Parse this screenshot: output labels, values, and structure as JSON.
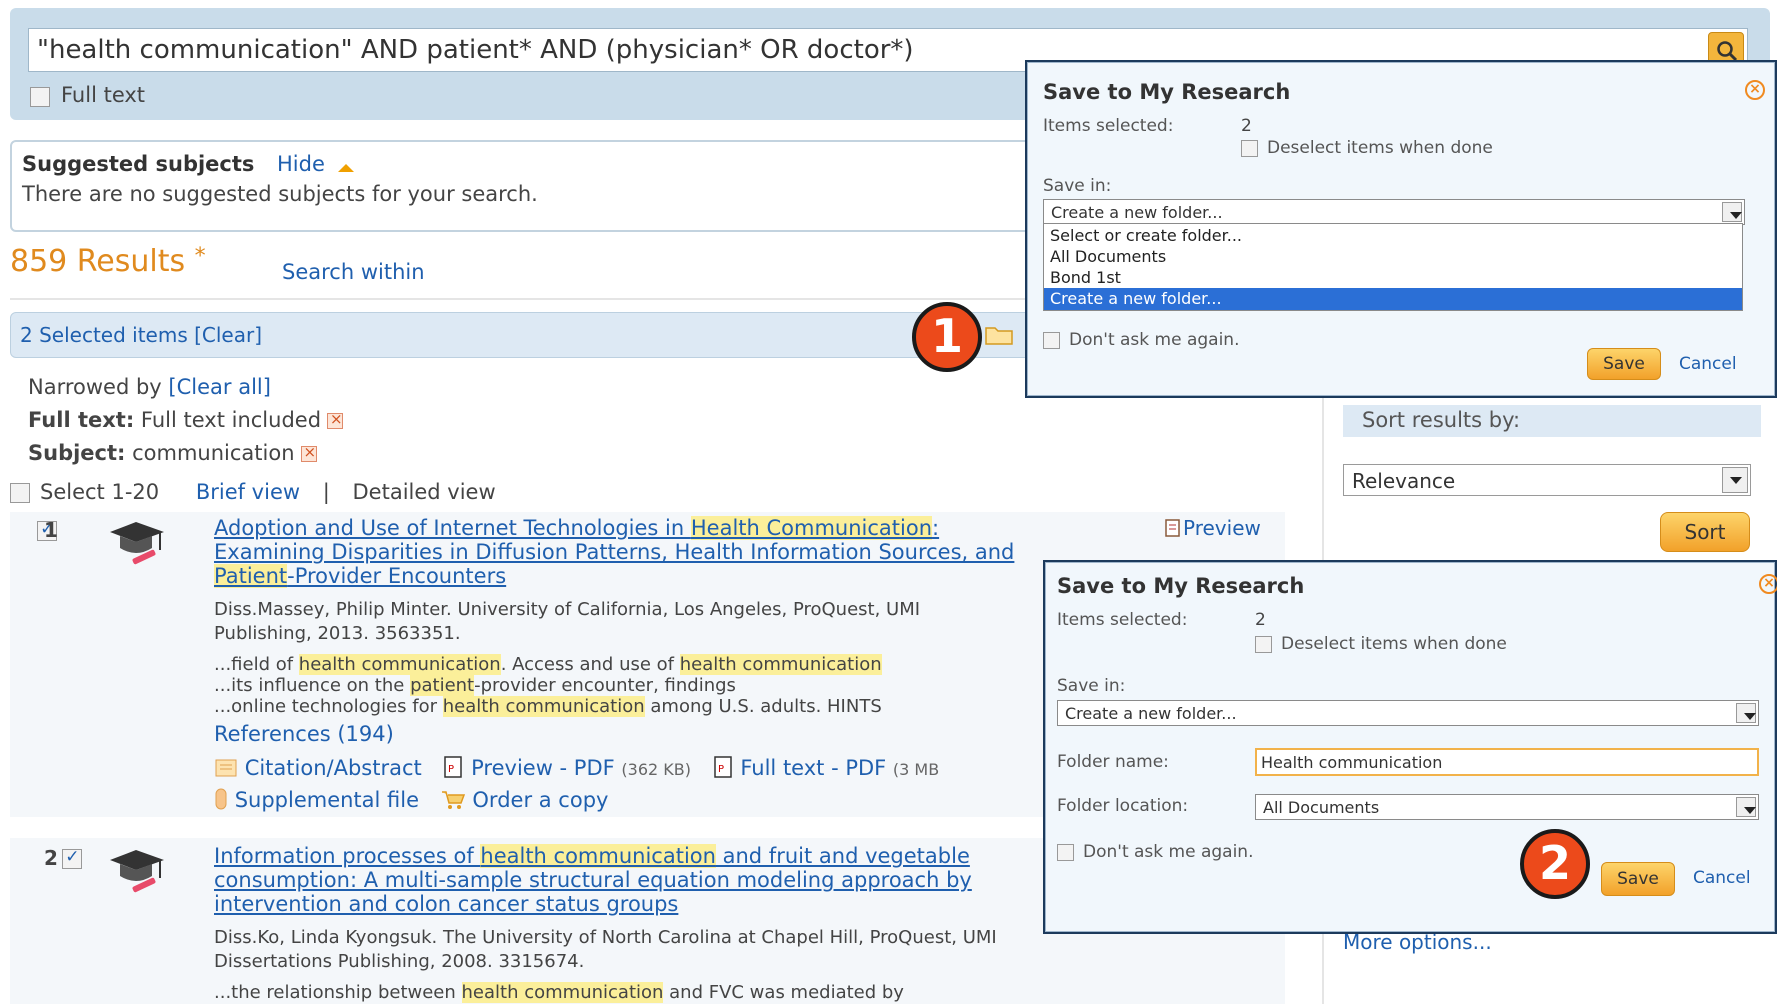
{
  "search": {
    "query": "\"health communication\" AND patient* AND (physician* OR doctor*)",
    "full_text_label": "Full text"
  },
  "suggested": {
    "title": "Suggested subjects",
    "hide": "Hide",
    "text": "There are no suggested subjects for your search."
  },
  "results": {
    "count": "859 Results",
    "asterisk": "*",
    "search_within": "Search within",
    "selected_text": "2 Selected items [Clear]",
    "narrowed_label": "Narrowed by ",
    "clear_all": "[Clear all]",
    "full_text_filter_label": "Full text:",
    "full_text_filter_value": " Full text included",
    "subject_filter_label": "Subject:",
    "subject_filter_value": " communication",
    "select_range": "Select 1-20",
    "brief_view": "Brief view",
    "separator": "|",
    "detailed_view": "Detailed view"
  },
  "result1": {
    "number": "1",
    "title_a": "Adoption and Use of Internet Technologies in ",
    "title_hl1": "Health Communication",
    "title_b": ":",
    "title_line2": "Examining Disparities in Diffusion Patterns, Health Information Sources, and",
    "title_hl2": "Patient",
    "title_c": "-Provider Encounters",
    "meta1": "Diss.Massey, Philip Minter. University of California, Los Angeles, ProQuest, UMI",
    "meta2": "Publishing, 2013. 3563351.",
    "snip1_a": "...field of ",
    "snip1_hl": "health communication",
    "snip1_b": ". Access and use of ",
    "snip1_hl2": "health communication",
    "snip2_a": "...its influence on the ",
    "snip2_hl": "patient",
    "snip2_b": "-provider encounter, findings",
    "snip3_a": "...online technologies for ",
    "snip3_hl": "health communication",
    "snip3_b": " among U.S. adults. HINTS",
    "references": "References (194)",
    "citation": "Citation/Abstract",
    "preview_pdf": "Preview - PDF",
    "preview_pdf_size": "(362 KB)",
    "full_text_pdf": "Full text - PDF",
    "full_text_pdf_size": "(3 MB",
    "supplemental": "Supplemental file",
    "order": "Order a copy",
    "preview": "Preview"
  },
  "result2": {
    "number": "2",
    "title_a": "Information processes of ",
    "title_hl": "health communication",
    "title_b": " and fruit and vegetable",
    "title_line2": "consumption: A multi-sample structural equation modeling approach by",
    "title_line3": "intervention and colon cancer status groups",
    "meta1": "Diss.Ko, Linda Kyongsuk. The University of North Carolina at Chapel Hill, ProQuest, UMI",
    "meta2": "Dissertations Publishing, 2008. 3315674.",
    "snip1_a": "...the relationship between ",
    "snip1_hl": "health communication",
    "snip1_b": " and FVC was mediated by"
  },
  "sidebar": {
    "sort_label": "Sort results by:",
    "sort_value": "Relevance",
    "sort_button": "Sort",
    "more_options": "More options..."
  },
  "dialog1": {
    "title": "Save to My Research",
    "items_selected_label": "Items selected:",
    "items_selected_value": "2",
    "deselect_label": "Deselect items when done",
    "save_in_label": "Save in:",
    "save_in_value": "Create a new folder...",
    "options": [
      "Select or create folder...",
      "All Documents",
      "Bond 1st",
      "Create a new folder..."
    ],
    "dont_ask": "Don't ask me again.",
    "save": "Save",
    "cancel": "Cancel"
  },
  "dialog2": {
    "title": "Save to My Research",
    "items_selected_label": "Items selected:",
    "items_selected_value": "2",
    "deselect_label": "Deselect items when done",
    "save_in_label": "Save in:",
    "save_in_value": "Create a new folder...",
    "folder_name_label": "Folder name:",
    "folder_name_value": "Health communication",
    "folder_location_label": "Folder location:",
    "folder_location_value": "All Documents",
    "dont_ask": "Don't ask me again.",
    "save": "Save",
    "cancel": "Cancel"
  },
  "badges": {
    "one": "1",
    "two": "2"
  },
  "colors": {
    "accent": "#f2a12a",
    "link": "#1f5fae",
    "highlight": "#fbef9a",
    "badge": "#ec4a1b",
    "results_count": "#e08a1e"
  }
}
